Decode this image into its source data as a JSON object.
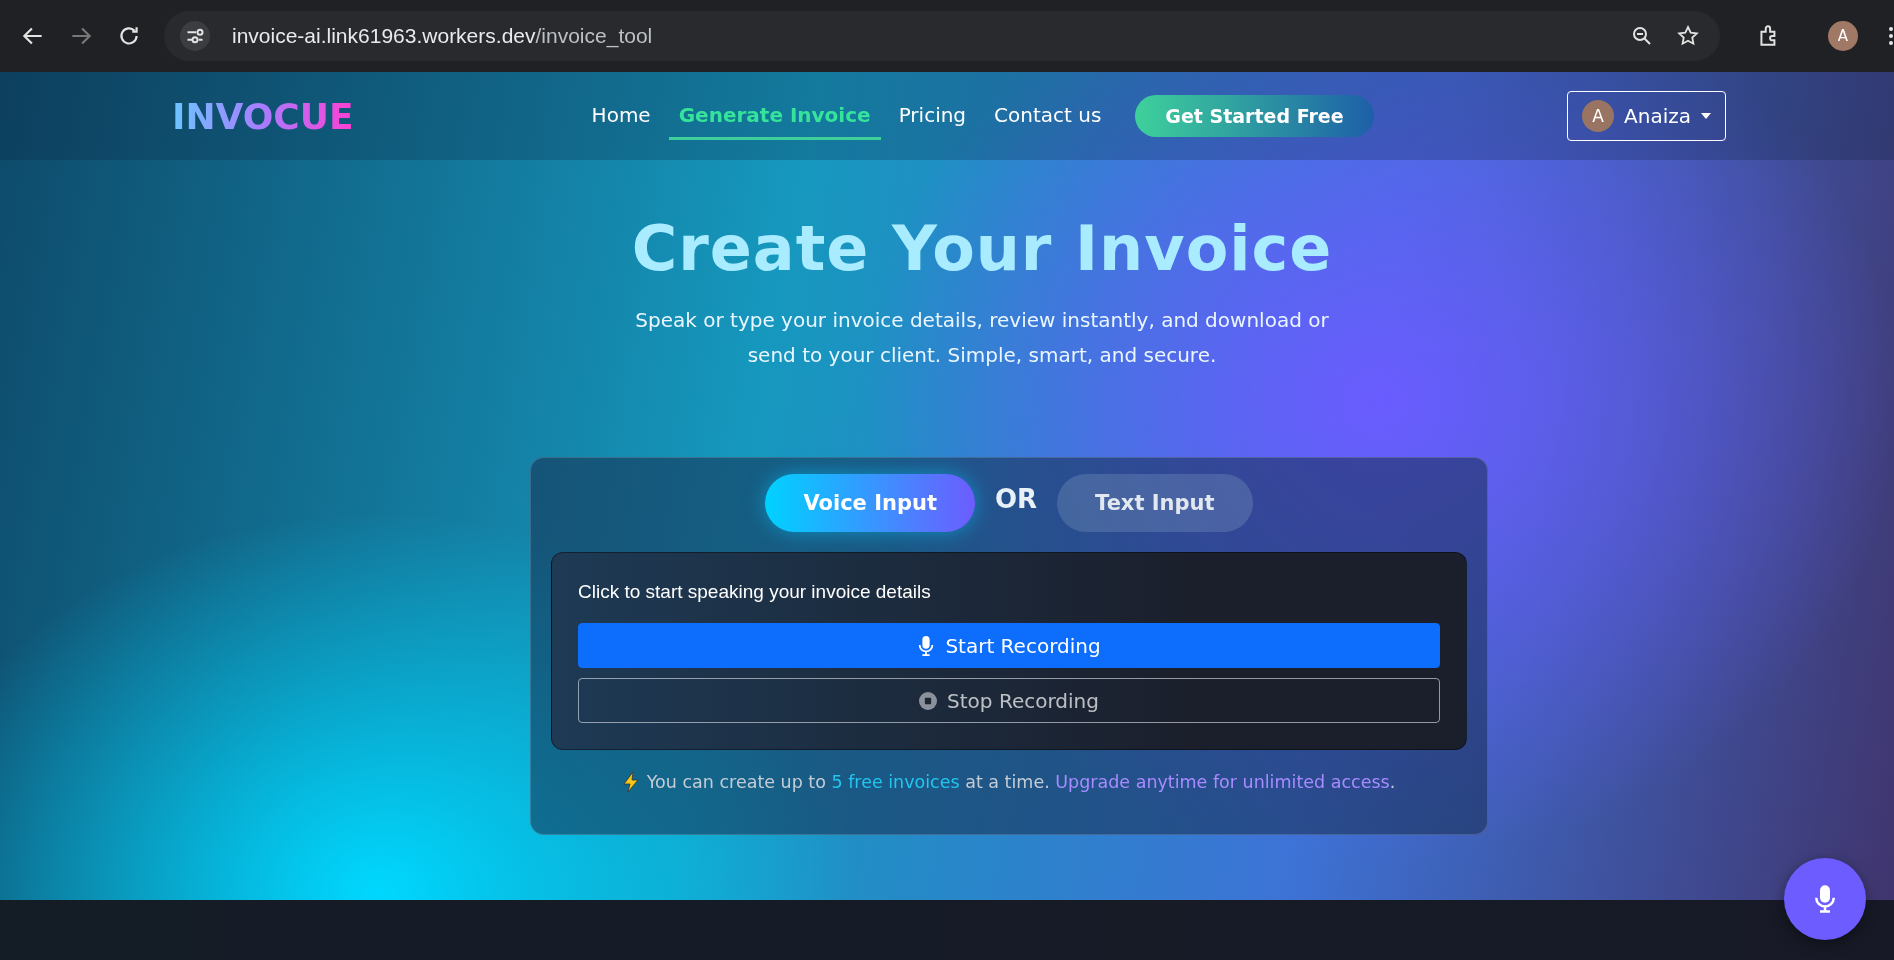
{
  "browser": {
    "url_host": "invoice-ai.link61963.workers.dev",
    "url_path": "/invoice_tool",
    "profile_initial": "A"
  },
  "nav": {
    "logo": "INVOCUE",
    "links": [
      {
        "label": "Home",
        "selected": false
      },
      {
        "label": "Generate Invoice",
        "selected": true
      },
      {
        "label": "Pricing",
        "selected": false
      },
      {
        "label": "Contact us",
        "selected": false
      }
    ],
    "cta": "Get Started Free",
    "user": {
      "initial": "A",
      "name": "Anaiza"
    }
  },
  "hero": {
    "title": "Create Your Invoice",
    "subtitle": "Speak or type your invoice details, review instantly, and download or send to your client. Simple, smart, and secure."
  },
  "mode_tabs": [
    {
      "label": "Voice Input",
      "selected": true
    },
    {
      "label": "Text Input",
      "selected": false
    }
  ],
  "mode_separator": "OR",
  "voice_panel": {
    "prompt": "Click to start speaking your invoice details",
    "buttons": [
      {
        "label": "Start Recording",
        "kind": "start",
        "disabled": false
      },
      {
        "label": "Stop Recording",
        "kind": "stop",
        "disabled": true
      }
    ]
  },
  "note": {
    "before": "You can create up to ",
    "highlight": "5 free invoices",
    "middle": " at a time. ",
    "link": "Upgrade anytime for unlimited access",
    "after": "."
  }
}
